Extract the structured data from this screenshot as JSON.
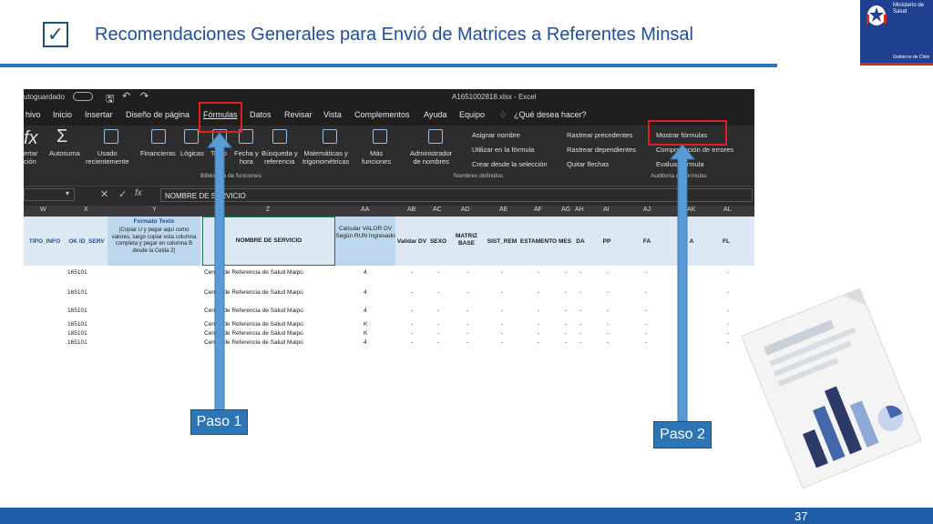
{
  "slide": {
    "title": "Recomendaciones Generales para Envió de Matrices a Referentes Minsal",
    "checkmark": "✓",
    "page_number": "37",
    "logo_line1": "Ministerio de",
    "logo_line2": "Salud",
    "logo_gov": "Gobierno de Chile"
  },
  "excel": {
    "autosave": "utoguardado",
    "filename": "A1651002818.xlsx - Excel",
    "tabs": [
      "hivo",
      "Inicio",
      "Insertar",
      "Diseño de página",
      "Fórmulas",
      "Datos",
      "Revisar",
      "Vista",
      "Complementos",
      "Ayuda",
      "Equipo"
    ],
    "tell_me": "¿Qué desea hacer?",
    "ribbon": {
      "insert_function": "ertar\nción",
      "autosum": "Autosuma",
      "recent": "Usado\nrecientemente",
      "financial": "Financieras",
      "logical": "Lógicas",
      "text": "Texto",
      "datetime": "Fecha y\nhora",
      "lookup": "Búsqueda y\nreferencia",
      "math": "Matemáticas y\ntrigonométricas",
      "more": "Más\nfunciones",
      "name_manager": "Administrador\nde nombres",
      "define_name": "Asignar nombre",
      "use_in_formula": "Utilizar en la fórmula",
      "create_from_selection": "Crear desde la selección",
      "trace_precedents": "Rastrear precedentes",
      "trace_dependents": "Rastrear dependientes",
      "remove_arrows": "Quitar flechas",
      "show_formulas": "Mostrar fórmulas",
      "error_checking": "Comprobación de errores",
      "evaluate": "Evaluar fórmula",
      "group_library": "Biblioteca de funciones",
      "group_names": "Nombres definidos",
      "group_audit": "Auditoría de fórmulas"
    },
    "formula_content": "NOMBRE DE SERVICIO",
    "columns": [
      "W",
      "X",
      "Y",
      "Z",
      "AA",
      "AB",
      "AC",
      "AD",
      "AE",
      "AF",
      "AG",
      "AH",
      "AI",
      "AJ",
      "AK",
      "AL"
    ],
    "header_cells": {
      "tipo": "TIPO_INFO",
      "okid": "OK ID_SERV",
      "formato_title": "Formato Texto",
      "formato_body": "(Copiar U y pegar aquí como valores, luego copiar esta columna completa y pegar en columna B desde la Celda 2)",
      "nombre": "NOMBRE DE SERVICIO",
      "calcular": "Calcular VALOR DV Según RUN Ingresado",
      "validar": "Validar DV",
      "sexo": "SEXO",
      "matriz": "MATRIZ BASE",
      "sist": "SIST_REM",
      "estamento": "ESTAMENTO",
      "mes": "MES",
      "da": "DA",
      "pp": "PP",
      "fa": "FA",
      "a": "A",
      "fl": "FL"
    },
    "rows": [
      {
        "id": "165101",
        "name": "Centro de Referencia de Salud Maipú",
        "dv": "4"
      },
      {
        "id": "165101",
        "name": "Centro de Referencia de Salud Maipú",
        "dv": "4"
      },
      {
        "id": "165101",
        "name": "Centro de Referencia de Salud Maipú",
        "dv": "4"
      },
      {
        "id": "165101",
        "name": "Centro de Referencia de Salud Maipú",
        "dv": "K"
      },
      {
        "id": "165101",
        "name": "Centro de Referencia de Salud Maipú",
        "dv": "K"
      },
      {
        "id": "165101",
        "name": "Centro de Referencia de Salud Maipú",
        "dv": "4"
      }
    ],
    "dash": "-"
  },
  "callouts": {
    "step1": "Paso 1",
    "step2": "Paso 2"
  },
  "colors": {
    "accent": "#2e75b6",
    "title": "#1f4e9a",
    "highlight": "#e02020"
  }
}
